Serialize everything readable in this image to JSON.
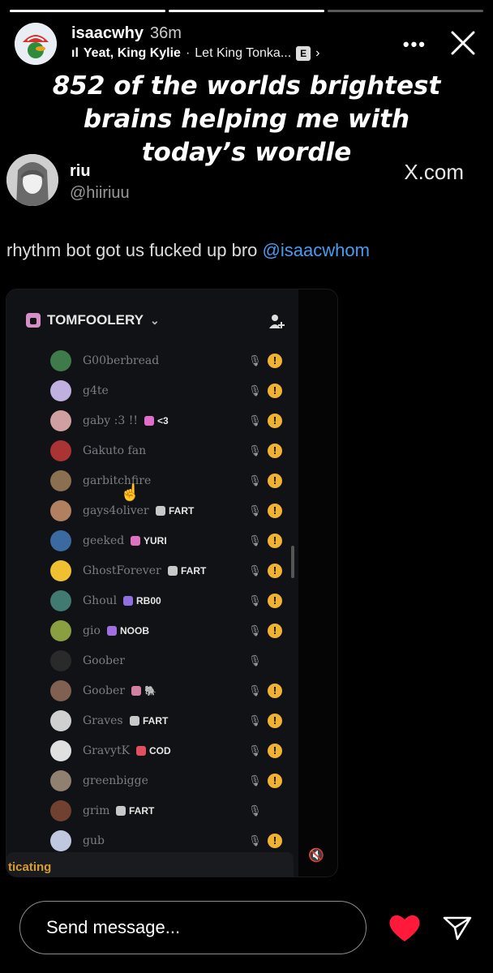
{
  "story": {
    "username": "isaacwhy",
    "time": "36m",
    "song": "Yeat, King Kylie",
    "artist": "Let King Tonka...",
    "explicit_badge": "E",
    "more_label": "•••",
    "progress": {
      "segments": 3,
      "current": 3
    }
  },
  "caption": {
    "lines": [
      "852 of the worlds brightest",
      "brains helping me with",
      "today’s wordle"
    ]
  },
  "tweet": {
    "name": "riu",
    "handle": "@hiiriuu",
    "source": "X.com",
    "text": "rhythm bot got us fucked up bro ",
    "mention": "@isaacwhom"
  },
  "discord": {
    "server_name": "TOMFOOLERY",
    "bottom_label": "ticating",
    "members": [
      {
        "name": "G00berbread",
        "tag": "",
        "tag_color": "",
        "avatar_color": "#3f7a4a",
        "muted": true,
        "warn": true
      },
      {
        "name": "g4te",
        "tag": "",
        "tag_color": "",
        "avatar_color": "#c0b0e0",
        "muted": true,
        "warn": true
      },
      {
        "name": "gaby :3 !!",
        "tag": "<3",
        "tag_color": "#e06ec8",
        "avatar_color": "#d0a0a0",
        "muted": true,
        "warn": true
      },
      {
        "name": "Gakuto fan",
        "tag": "",
        "tag_color": "",
        "avatar_color": "#aa3333",
        "muted": true,
        "warn": true
      },
      {
        "name": "garbitchfire",
        "tag": "",
        "tag_color": "",
        "avatar_color": "#8a7050",
        "muted": true,
        "warn": true
      },
      {
        "name": "gays4oliver",
        "tag": "FART",
        "tag_color": "#c8c8c8",
        "avatar_color": "#b08060",
        "muted": true,
        "warn": true
      },
      {
        "name": "geeked",
        "tag": "YURI",
        "tag_color": "#e070c0",
        "avatar_color": "#3a6aa0",
        "muted": true,
        "warn": true
      },
      {
        "name": "GhostForever",
        "tag": "FART",
        "tag_color": "#c8c8c8",
        "avatar_color": "#f0c030",
        "muted": true,
        "warn": true
      },
      {
        "name": "Ghoul",
        "tag": "RB00",
        "tag_color": "#9070e0",
        "avatar_color": "#407a70",
        "muted": true,
        "warn": true
      },
      {
        "name": "gio",
        "tag": "NOOB",
        "tag_color": "#a070e0",
        "avatar_color": "#8aa040",
        "muted": true,
        "warn": true
      },
      {
        "name": "Goober",
        "tag": "",
        "tag_color": "",
        "avatar_color": "#2a2a2a",
        "muted": true,
        "warn": false
      },
      {
        "name": "Goober",
        "tag": "🐘",
        "tag_color": "#d080a0",
        "avatar_color": "#806050",
        "muted": true,
        "warn": true
      },
      {
        "name": "Graves",
        "tag": "FART",
        "tag_color": "#c8c8c8",
        "avatar_color": "#d0d0d0",
        "muted": true,
        "warn": true
      },
      {
        "name": "GravytK",
        "tag": "COD",
        "tag_color": "#e05060",
        "avatar_color": "#e0e0e0",
        "muted": true,
        "warn": true
      },
      {
        "name": "greenbigge",
        "tag": "",
        "tag_color": "",
        "avatar_color": "#908070",
        "muted": true,
        "warn": true
      },
      {
        "name": "grim",
        "tag": "FART",
        "tag_color": "#c8c8c8",
        "avatar_color": "#704030",
        "muted": true,
        "warn": false
      },
      {
        "name": "gub",
        "tag": "",
        "tag_color": "",
        "avatar_color": "#c0c8e0",
        "muted": true,
        "warn": true
      }
    ]
  },
  "composer": {
    "placeholder": "Send message..."
  },
  "colors": {
    "mention": "#4a9bf0",
    "warn": "#f0b232",
    "like": "#ff1a3c"
  }
}
